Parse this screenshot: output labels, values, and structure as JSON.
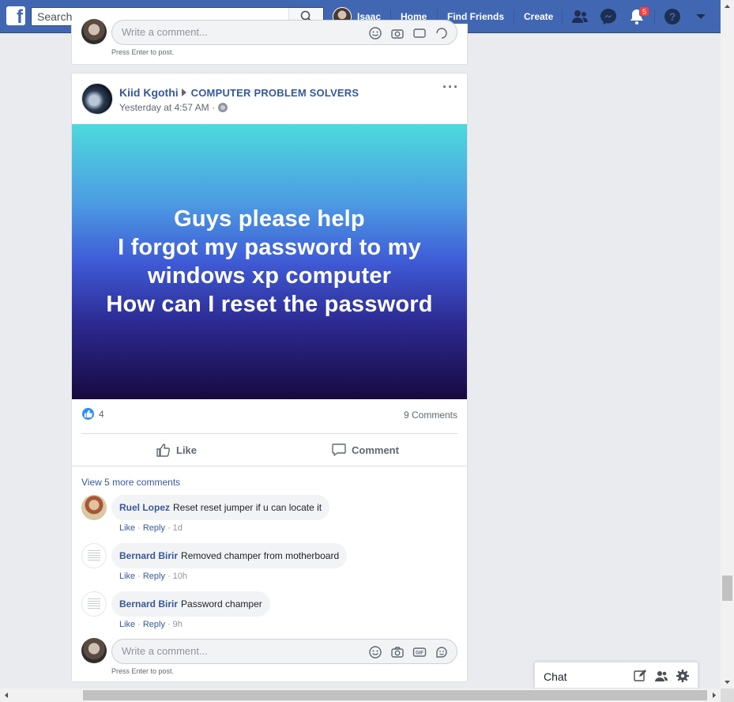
{
  "header": {
    "search_placeholder": "Search",
    "user_name": "Isaac",
    "nav": [
      "Home",
      "Find Friends",
      "Create"
    ],
    "notifications_count": "5",
    "brand_color": "#4267b2"
  },
  "top_composer": {
    "placeholder": "Write a comment...",
    "hint": "Press Enter to post."
  },
  "post": {
    "author": "Kiid Kgothi",
    "group": "COMPUTER PROBLEM SOLVERS",
    "time": "Yesterday at 4:57 AM ·",
    "body": "Guys please help\nI forgot my password to my\nwindows xp computer\nHow can I reset the password",
    "reaction_count": "4",
    "comments_count": "9 Comments",
    "actions": {
      "like": "Like",
      "comment": "Comment"
    },
    "view_more": "View 5 more comments",
    "comments": [
      {
        "name": "Ruel Lopez",
        "text": "Reset reset jumper if u can locate it",
        "like": "Like",
        "reply": "Reply",
        "time": "1d"
      },
      {
        "name": "Bernard Birir",
        "text": "Removed champer from motherboard",
        "like": "Like",
        "reply": "Reply",
        "time": "10h"
      },
      {
        "name": "Bernard Birir",
        "text": "Password champer",
        "like": "Like",
        "reply": "Reply",
        "time": "9h"
      }
    ],
    "composer": {
      "placeholder": "Write a comment...",
      "hint": "Press Enter to post."
    }
  },
  "chat": {
    "label": "Chat"
  }
}
